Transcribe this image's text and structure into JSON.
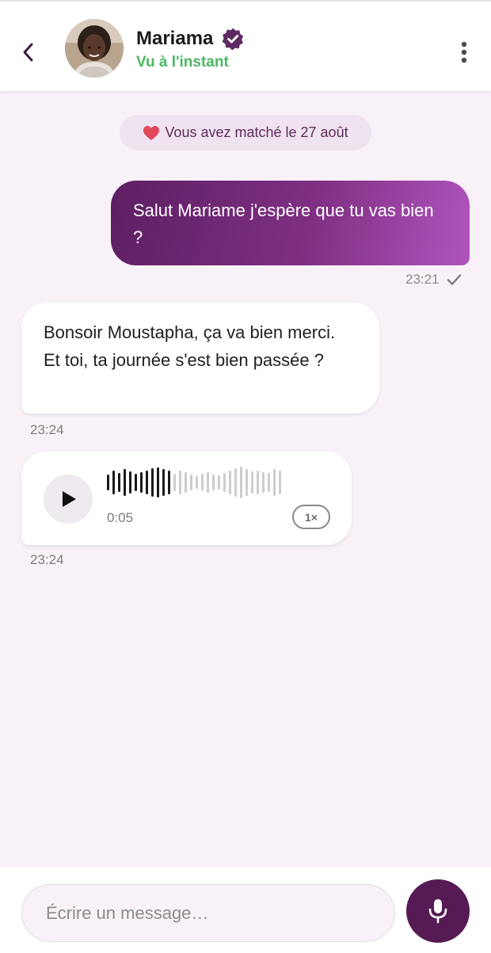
{
  "contact": {
    "name": "Mariama",
    "status": "Vu à l'instant",
    "verified": true
  },
  "match_banner": {
    "text": "Vous avez matché le 27 août"
  },
  "messages": [
    {
      "direction": "outgoing",
      "text": "Salut Mariame j'espère que tu vas bien ?",
      "time": "23:21",
      "read_status": "sent"
    },
    {
      "direction": "incoming",
      "text": "Bonsoir Moustapha, ça va bien merci. Et toi, ta journée s'est bien passée ?",
      "time": "23:24"
    },
    {
      "direction": "incoming",
      "type": "voice",
      "duration": "0:05",
      "speed": "1×",
      "time": "23:24"
    }
  ],
  "composer": {
    "placeholder": "Écrire un message…"
  },
  "colors": {
    "brand": "#561b55",
    "bubble_gradient_start": "#5d1f63",
    "bubble_gradient_end": "#b054bd",
    "online_green": "#4cb863",
    "background": "#f8f2f8"
  },
  "icons": {
    "back": "chevron-left-icon",
    "verified": "verified-badge-icon",
    "more": "more-vertical-icon",
    "heart": "heart-icon",
    "read": "check-icon",
    "play": "play-icon",
    "mic": "microphone-icon"
  }
}
